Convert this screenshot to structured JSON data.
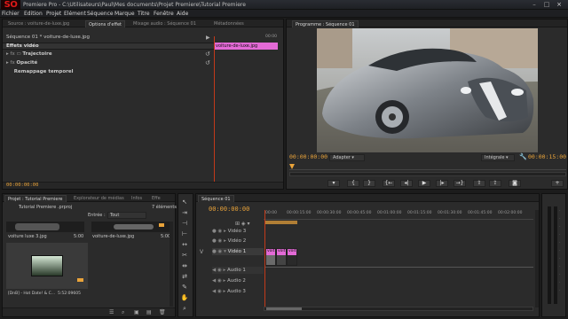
{
  "window": {
    "title": "Premiere Pro - C:\\Utilisateurs\\Paul\\Mes documents\\Projet Premiere\\Tutorial Premiere",
    "logo": "SO",
    "controls": [
      "–",
      "□",
      "×"
    ]
  },
  "menu": [
    "Fichier",
    "Edition",
    "Projet",
    "Elément",
    "Séquence",
    "Marque",
    "Titre",
    "Fenêtre",
    "Aide"
  ],
  "source_panel": {
    "tabs": [
      "Source : voiture-de-luxe.jpg",
      "Options d'effet",
      "Mixage audio : Séquence 01",
      "Métadonnées"
    ],
    "active_tab": 1,
    "clip_header": "Séquence 01 * voiture-de-luxe.jpg",
    "ruler_time": "00:00",
    "clip_bar_label": "voiture-de-luxe.jpg",
    "section": "Effets vidéo",
    "effects": [
      "Trajectoire",
      "Opacité",
      "Remappage temporel"
    ],
    "footer_tc": "00:00:00:00"
  },
  "program": {
    "tab": "Programme : Séquence 01",
    "tc_left": "00:00:00:00",
    "fit": "Adapter",
    "quality": "Intégrale",
    "tc_right": "00:00:15:00"
  },
  "project": {
    "tabs": [
      "Projet : Tutorial Premiere",
      "Explorateur de médias",
      "Infos",
      "Effe"
    ],
    "project_file": "Tutorial Premiere .prproj",
    "count": "7 éléments",
    "entry_label": "Entrée :",
    "entry_value": "Tout",
    "items": [
      {
        "name": "voiture luxe 3.jpg",
        "dur": "5:00"
      },
      {
        "name": "voiture-de-luxe.jpg",
        "dur": "5:00"
      }
    ],
    "clip_name": "[DnB] - Hot Date! & C...",
    "clip_dur": "5:52:09605"
  },
  "timeline": {
    "tab": "Séquence 01",
    "tc": "00:00:00:00",
    "ruler": [
      "00:00",
      "00:00:15:00",
      "00:00:30:00",
      "00:00:45:00",
      "00:01:00:00",
      "00:01:15:00",
      "00:01:30:00",
      "00:01:45:00",
      "00:02:00:00"
    ],
    "video_tracks": [
      "Vidéo 3",
      "Vidéo 2",
      "Vidéo 1"
    ],
    "audio_tracks": [
      "Audio 1",
      "Audio 2",
      "Audio 3"
    ],
    "clips": [
      "voit",
      "voit",
      "voit"
    ]
  },
  "icons": [
    "play-icon",
    "step-back-icon",
    "step-forward-icon",
    "loop-icon",
    "camera-icon",
    "wrench-icon",
    "selection-tool-icon",
    "razor-tool-icon",
    "hand-tool-icon",
    "zoom-tool-icon",
    "folder-icon",
    "trash-icon"
  ]
}
